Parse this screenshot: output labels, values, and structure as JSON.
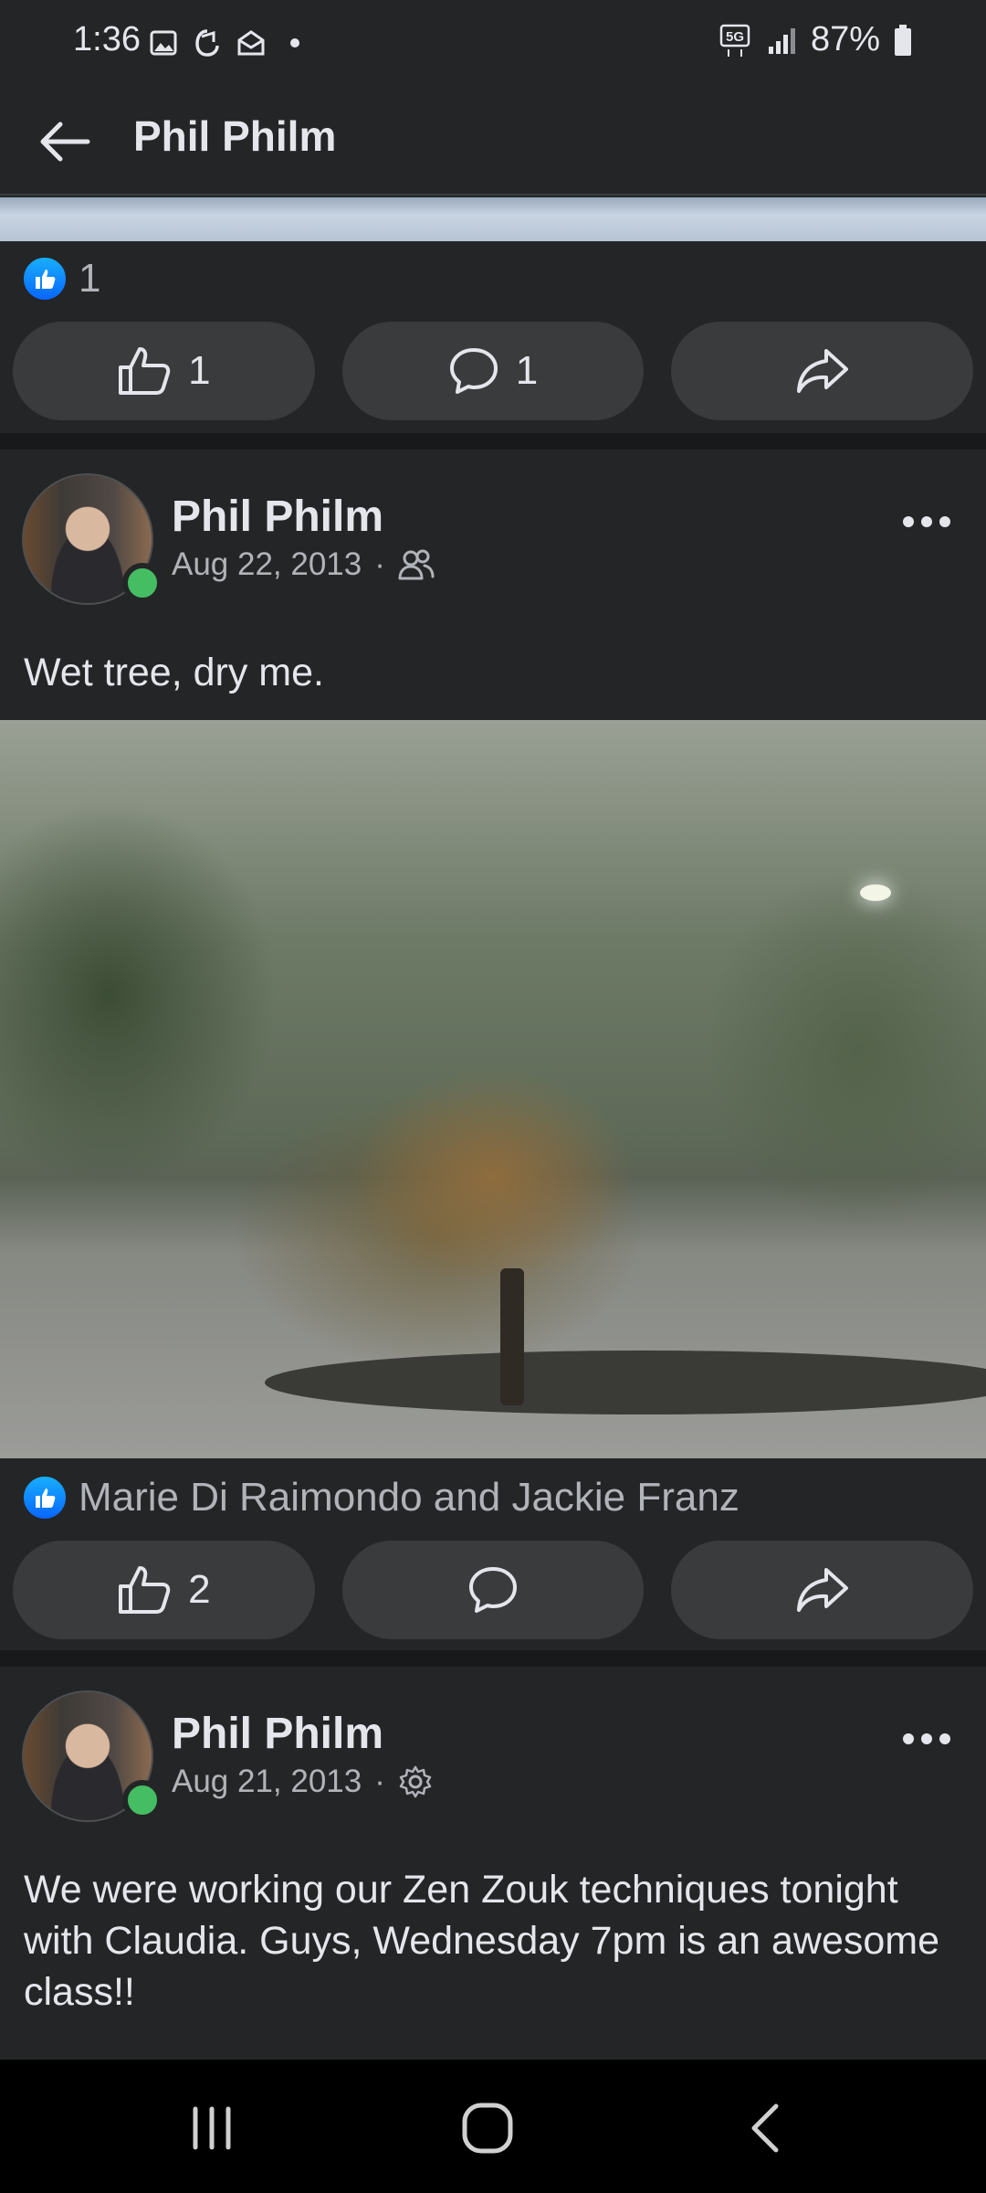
{
  "status_bar": {
    "time": "1:36",
    "network": "5G",
    "battery": "87%"
  },
  "header": {
    "title": "Phil Philm"
  },
  "previous_post": {
    "reaction_count": "1",
    "like_count": "1",
    "comment_count": "1"
  },
  "posts": [
    {
      "author": "Phil Philm",
      "date": "Aug 22, 2013",
      "separator": "·",
      "audience_icon": "friends-icon",
      "text": "Wet tree, dry me.",
      "reactions": "Marie Di Raimondo and Jackie Franz",
      "like_count": "2",
      "comment_count": ""
    },
    {
      "author": "Phil Philm",
      "date": "Aug 21, 2013",
      "separator": "·",
      "audience_icon": "gear-icon",
      "text": "We were working our Zen Zouk techniques tonight with Claudia. Guys, Wednesday 7pm is an awesome class!!"
    }
  ],
  "colors": {
    "background": "#242526",
    "button": "#3a3b3c",
    "like_blue": "#0866ff",
    "online_green": "#45bd62"
  }
}
